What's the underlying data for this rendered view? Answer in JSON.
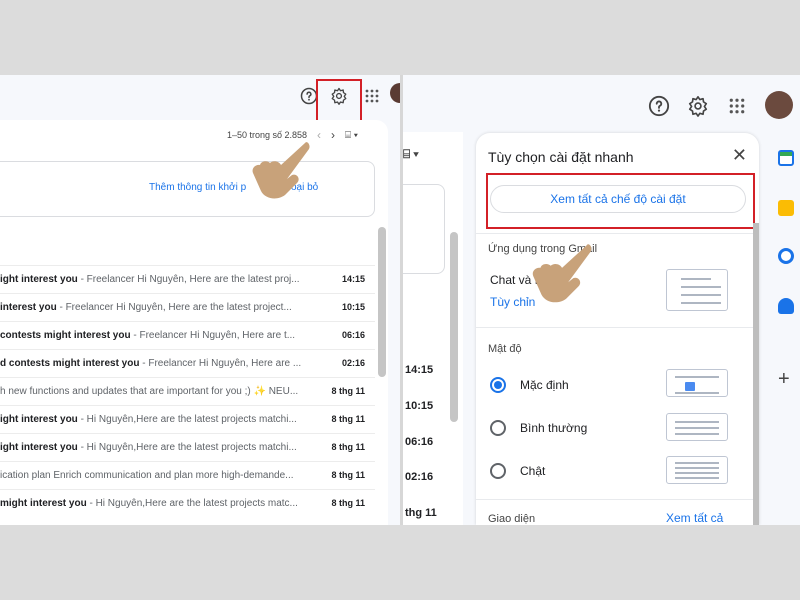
{
  "left": {
    "pager": {
      "range": "1–50 trong số 2.858"
    },
    "promo": {
      "text": "Thêm thông tin khởi p",
      "dismiss": "oại bỏ"
    },
    "emails": [
      {
        "subject": "ight interest you",
        "snippet": " - Freelancer Hi Nguyên, Here are the latest proj...",
        "time": "14:15"
      },
      {
        "subject": " interest you",
        "snippet": " - Freelancer Hi Nguyên, Here are the latest project...",
        "time": "10:15"
      },
      {
        "subject": "contests might interest you",
        "snippet": " - Freelancer Hi Nguyên, Here are t...",
        "time": "06:16"
      },
      {
        "subject": "d contests might interest you",
        "snippet": " - Freelancer Hi Nguyên, Here are ...",
        "time": "02:16"
      },
      {
        "subject": "",
        "snippet": "h new functions and updates that are important for you ;) ✨ NEU...",
        "time": "8 thg 11"
      },
      {
        "subject": "ight interest you",
        "snippet": " - Hi Nguyên,Here are the latest projects matchi...",
        "time": "8 thg 11"
      },
      {
        "subject": "ight interest you",
        "snippet": " - Hi Nguyên,Here are the latest projects matchi...",
        "time": "8 thg 11"
      },
      {
        "subject": "",
        "snippet": "ication plan Enrich communication and plan more high-demande...",
        "time": "8 thg 11"
      },
      {
        "subject": " might interest you",
        "snippet": " - Hi Nguyên,Here are the latest projects matc...",
        "time": "8 thg 11"
      }
    ]
  },
  "right": {
    "behind": {
      "times": [
        "14:15",
        "10:15",
        "06:16",
        "02:16",
        "thg 11"
      ]
    },
    "quick_settings": {
      "title": "Tùy chọn cài đặt nhanh",
      "close": "✕",
      "see_all_button": "Xem tất cả chế độ cài đặt",
      "apps_heading": "Ứng dụng trong Gmail",
      "apps_line": "Chat và M",
      "apps_link": "Tùy chỉn",
      "density_heading": "Mật độ",
      "density_options": [
        "Mặc định",
        "Bình thường",
        "Chật"
      ],
      "theme_heading": "Giao diện",
      "theme_link": "Xem tất cả"
    }
  },
  "colors": {
    "highlight": "#d32027",
    "link": "#1a73e8",
    "hand": "#c8a27a"
  }
}
